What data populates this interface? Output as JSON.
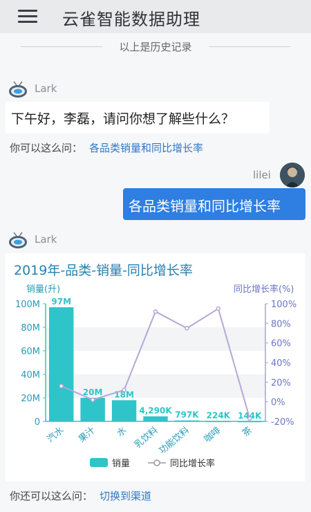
{
  "header": {
    "title": "云雀智能数据助理",
    "menu_icon": "hamburger-menu-icon"
  },
  "history": {
    "text": "以上是历史记录"
  },
  "bot": {
    "name": "Lark",
    "avatar_icon": "robot-avatar-icon"
  },
  "messages": {
    "greeting": "下午好，李磊，请问你想了解些什么？",
    "suggest_label": "你可以这么问：",
    "suggest_link": "各品类销量和同比增长率",
    "user_name": "lilei",
    "user_message": "各品类销量和同比增长率",
    "suggest2_label": "你还可以这么问：",
    "suggest2_link": "切换到渠道"
  },
  "colors": {
    "bar": "#2ec4c9",
    "line": "#b6a6d6",
    "title": "#2a7fb0",
    "link": "#2f78c4",
    "user_bubble": "#2f7ee2"
  },
  "chart_data": {
    "type": "bar",
    "title": "2019年-品类-销量-同比增长率",
    "ylabel": "销量(升)",
    "y2label": "同比增长率(%)",
    "categories": [
      "汽水",
      "果汁",
      "水",
      "乳饮料",
      "功能饮料",
      "咖啡",
      "茶"
    ],
    "ylim": [
      0,
      100000000
    ],
    "y_ticks": [
      "0",
      "20M",
      "40M",
      "60M",
      "80M",
      "100M"
    ],
    "y2lim": [
      -20,
      100
    ],
    "y2_ticks": [
      "-20%",
      "0%",
      "20%",
      "40%",
      "60%",
      "80%",
      "100%"
    ],
    "series": [
      {
        "name": "销量",
        "type": "bar",
        "values": [
          97000000,
          20000000,
          18000000,
          4290000,
          797000,
          224000,
          144000
        ],
        "labels": [
          "97M",
          "20M",
          "18M",
          "4,290K",
          "797K",
          "224K",
          "144K"
        ]
      },
      {
        "name": "同比增长率",
        "type": "line",
        "axis": "right",
        "values": [
          16,
          2,
          12,
          92,
          75,
          95,
          -17
        ]
      }
    ],
    "grid": true,
    "legend": "bottom"
  }
}
